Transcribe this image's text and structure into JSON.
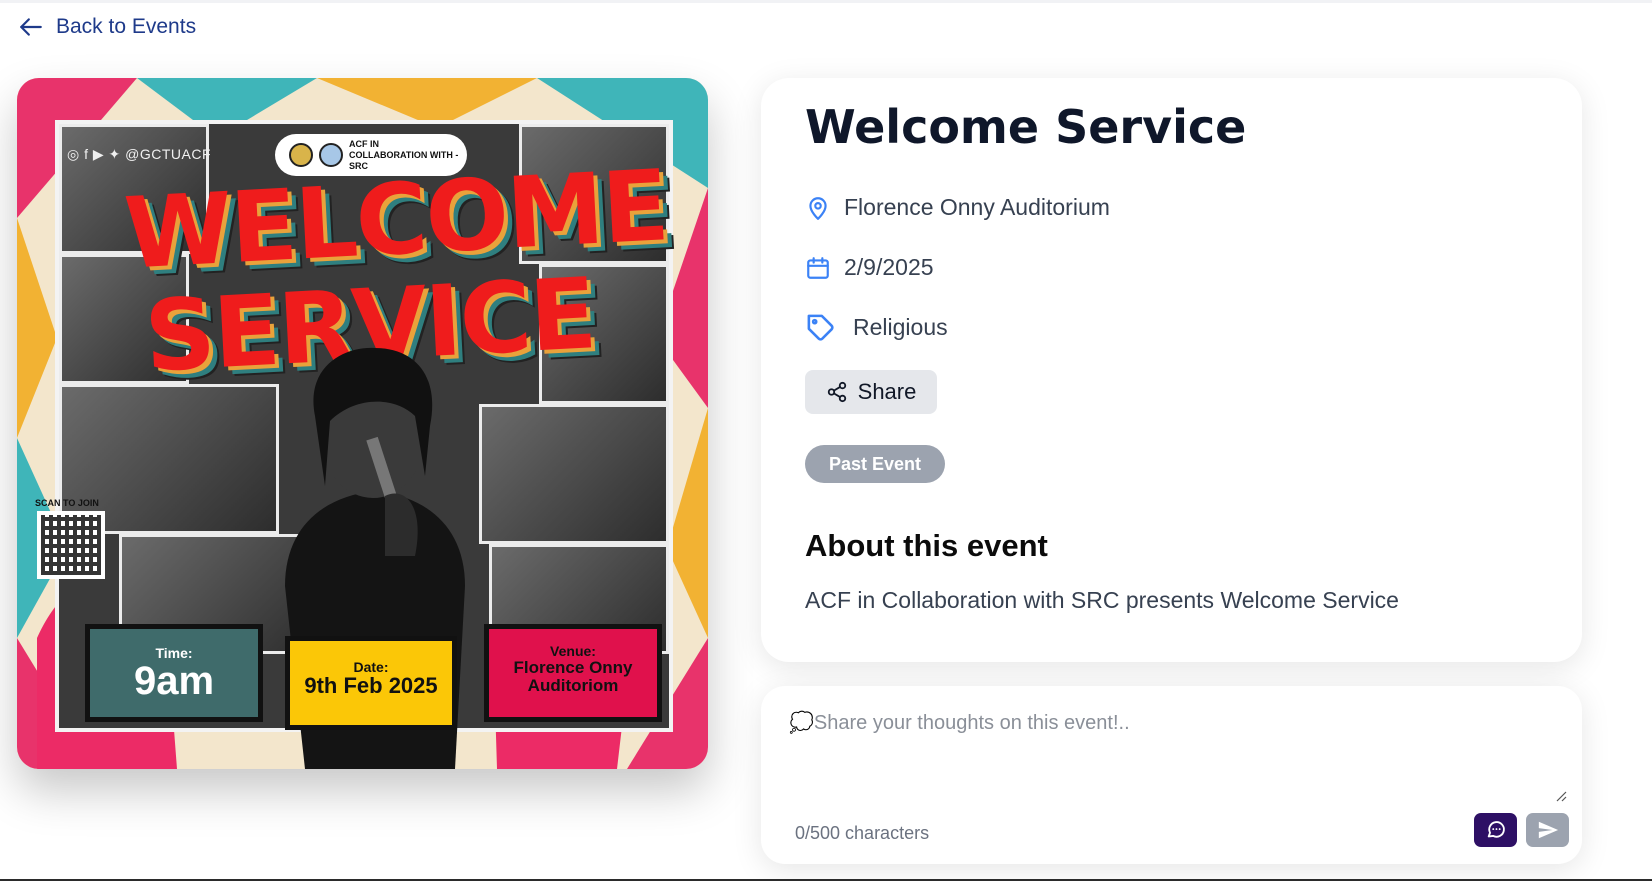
{
  "nav": {
    "back_label": "Back to Events"
  },
  "poster": {
    "social_handle": "@GCTUACF",
    "collab_text": "ACF IN COLLABORATION WITH - SRC",
    "headline_line1": "WELCOME",
    "headline_line2": "SERVICE",
    "scan_label": "SCAN TO JOIN",
    "time_label": "Time:",
    "time_value": "9am",
    "date_label": "Date:",
    "date_value": "9th Feb 2025",
    "venue_label": "Venue:",
    "venue_value": "Florence Onny Auditoriom"
  },
  "event": {
    "title": "Welcome Service",
    "location": "Florence Onny Auditorium",
    "date": "2/9/2025",
    "category": "Religious",
    "share_label": "Share",
    "status": "Past Event",
    "about_heading": "About this event",
    "description": "ACF in Collaboration with SRC presents Welcome Service"
  },
  "comment": {
    "placeholder": "💭Share your thoughts on this event!..",
    "char_count": "0/500 characters"
  },
  "colors": {
    "accent": "#1e3a8a",
    "icon_blue": "#3b82f6",
    "badge_gray": "#9ca3af",
    "chat_button": "#2e1065"
  }
}
